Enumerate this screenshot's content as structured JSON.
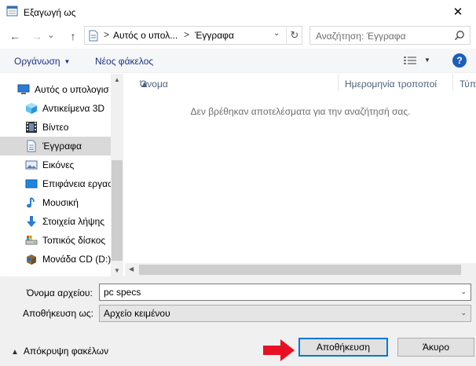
{
  "window": {
    "title": "Εξαγωγή ως",
    "close_glyph": "✕"
  },
  "nav": {
    "back_glyph": "←",
    "forward_glyph": "→",
    "recent_glyph": "⌄",
    "up_glyph": "↑",
    "breadcrumbs": [
      "Αυτός ο υπολ...",
      "Έγγραφα"
    ],
    "breadcrumb_sep": ">",
    "refresh_glyph": "↻",
    "dropdown_glyph": "⌄",
    "search_placeholder": "Αναζήτηση: Έγγραφα"
  },
  "toolbar": {
    "organize_label": "Οργάνωση",
    "new_folder_label": "Νέος φάκελος",
    "help_label": "?"
  },
  "sidebar": {
    "items": [
      {
        "label": "Αυτός ο υπολογισ",
        "icon": "computer-icon",
        "selected": false
      },
      {
        "label": "Αντικείμενα 3D",
        "icon": "cube-3d-icon",
        "selected": false
      },
      {
        "label": "Βίντεο",
        "icon": "video-icon",
        "selected": false
      },
      {
        "label": "Έγγραφα",
        "icon": "document-icon",
        "selected": true
      },
      {
        "label": "Εικόνες",
        "icon": "pictures-icon",
        "selected": false
      },
      {
        "label": "Επιφάνεια εργασ",
        "icon": "desktop-icon",
        "selected": false
      },
      {
        "label": "Μουσική",
        "icon": "music-icon",
        "selected": false
      },
      {
        "label": "Στοιχεία λήψης",
        "icon": "download-icon",
        "selected": false
      },
      {
        "label": "Τοπικός δίσκος",
        "icon": "local-disk-icon",
        "selected": false
      },
      {
        "label": "Μονάδα CD (D:)",
        "icon": "cd-drive-icon",
        "selected": false
      }
    ]
  },
  "content": {
    "columns": [
      "Όνομα",
      "Ημερομηνία τροποποί",
      "Τύπ"
    ],
    "empty_message": "Δεν βρέθηκαν αποτελέσματα για την αναζήτησή σας."
  },
  "form": {
    "filename_label": "Όνομα αρχείου:",
    "filename_value": "pc specs",
    "savetype_label": "Αποθήκευση ως:",
    "savetype_value": "Αρχείο κειμένου",
    "hide_folders_label": "Απόκρυψη φακέλων",
    "save_button": "Αποθήκευση",
    "cancel_button": "Άκυρο"
  },
  "colors": {
    "accent_blue": "#0078d7",
    "link_blue": "#1e3287",
    "annotation_red": "#e81123"
  }
}
